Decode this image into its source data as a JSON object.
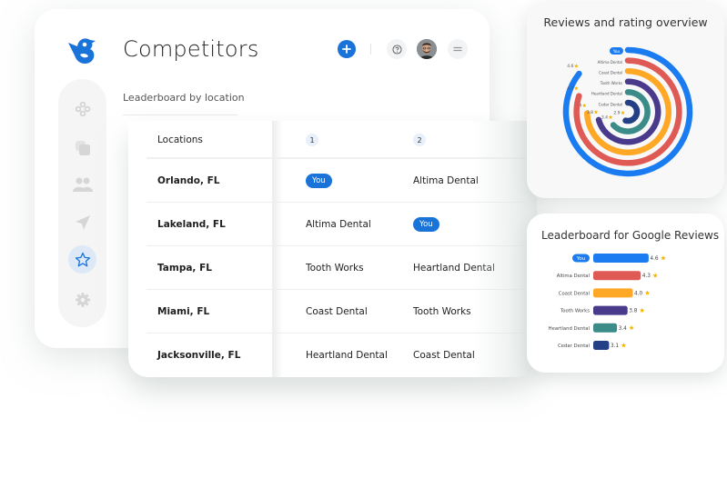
{
  "header": {
    "title": "Competitors",
    "add_icon": "plus-icon",
    "help_icon": "question-circle-icon",
    "menu_icon": "hamburger-icon",
    "avatar": "user-avatar"
  },
  "brand": {
    "accent": "#1a73d9"
  },
  "sidebar": {
    "items": [
      {
        "icon": "dashboard-dots-icon",
        "active": false
      },
      {
        "icon": "layers-icon",
        "active": false
      },
      {
        "icon": "users-icon",
        "active": false
      },
      {
        "icon": "send-icon",
        "active": false
      },
      {
        "icon": "star-icon",
        "active": true
      },
      {
        "icon": "gear-icon",
        "active": false
      }
    ]
  },
  "leaderboard": {
    "subtitle": "Leaderboard by location",
    "columns": [
      "Locations",
      "1",
      "2"
    ],
    "rows": [
      {
        "location": "Orlando, FL",
        "rank1": "You",
        "rank2": "Altima Dental"
      },
      {
        "location": "Lakeland, FL",
        "rank1": "Altima Dental",
        "rank2": "You"
      },
      {
        "location": "Tampa, FL",
        "rank1": "Tooth Works",
        "rank2": "Heartland Dental"
      },
      {
        "location": "Miami, FL",
        "rank1": "Coast Dental",
        "rank2": "Tooth Works"
      },
      {
        "location": "Jacksonville, FL",
        "rank1": "Heartland Dental",
        "rank2": "Coast Dental"
      }
    ]
  },
  "chart_data": [
    {
      "type": "radial-bar",
      "title": "Reviews and rating overview",
      "categories": [
        "You",
        "Altima Dental",
        "Coast Dental",
        "Tooth Works",
        "Heartland Dental",
        "Cedar Dental"
      ],
      "values": [
        4.6,
        4.3,
        4,
        3.8,
        3.4,
        2.9
      ],
      "value_labels": [
        "4.6",
        "4.3",
        "4",
        "3.8",
        "3.4",
        "2.9"
      ],
      "colors": [
        "#1a7cf0",
        "#e05a55",
        "#ffa826",
        "#4a3a8c",
        "#3b8c88",
        "#233f86"
      ],
      "highlight": "You",
      "star_color": "#f7b500"
    },
    {
      "type": "bar",
      "orientation": "horizontal",
      "title": "Leaderboard for Google Reviews",
      "categories": [
        "You",
        "Altima Dental",
        "Coast Dental",
        "Tooth Works",
        "Heartland Dental",
        "Cedar Dental"
      ],
      "values": [
        4.6,
        4.3,
        4.0,
        3.8,
        3.4,
        3.1
      ],
      "value_labels": [
        "4.6",
        "4.3",
        "4.0",
        "3.8",
        "3.4",
        "3.1"
      ],
      "colors": [
        "#1a7cf0",
        "#e05a55",
        "#ffa826",
        "#4a3a8c",
        "#3b8c88",
        "#233f86"
      ],
      "highlight": "You",
      "star_color": "#f7b500"
    }
  ]
}
